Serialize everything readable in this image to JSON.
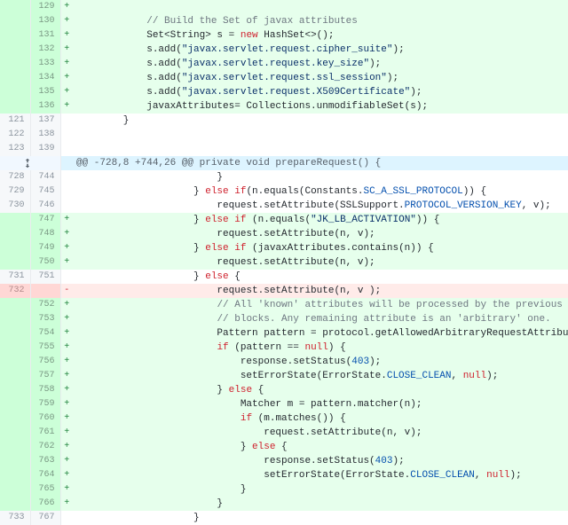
{
  "hunk_header": "@@ -728,8 +744,26 @@ private void prepareRequest() {",
  "lines": [
    {
      "o": "",
      "n": "129",
      "m": "+",
      "t": "add",
      "seg": [
        [
          "",
          ""
        ]
      ]
    },
    {
      "o": "",
      "n": "130",
      "m": "+",
      "t": "add",
      "seg": [
        [
          "",
          "            "
        ],
        [
          "cmt",
          "// Build the Set of javax attributes"
        ]
      ]
    },
    {
      "o": "",
      "n": "131",
      "m": "+",
      "t": "add",
      "seg": [
        [
          "",
          "            Set<String> s = "
        ],
        [
          "kw",
          "new"
        ],
        [
          "",
          " HashSet<>();"
        ]
      ]
    },
    {
      "o": "",
      "n": "132",
      "m": "+",
      "t": "add",
      "seg": [
        [
          "",
          "            s.add("
        ],
        [
          "str",
          "\"javax.servlet.request.cipher_suite\""
        ],
        [
          "",
          ");"
        ]
      ]
    },
    {
      "o": "",
      "n": "133",
      "m": "+",
      "t": "add",
      "seg": [
        [
          "",
          "            s.add("
        ],
        [
          "str",
          "\"javax.servlet.request.key_size\""
        ],
        [
          "",
          ");"
        ]
      ]
    },
    {
      "o": "",
      "n": "134",
      "m": "+",
      "t": "add",
      "seg": [
        [
          "",
          "            s.add("
        ],
        [
          "str",
          "\"javax.servlet.request.ssl_session\""
        ],
        [
          "",
          ");"
        ]
      ]
    },
    {
      "o": "",
      "n": "135",
      "m": "+",
      "t": "add",
      "seg": [
        [
          "",
          "            s.add("
        ],
        [
          "str",
          "\"javax.servlet.request.X509Certificate\""
        ],
        [
          "",
          ");"
        ]
      ]
    },
    {
      "o": "",
      "n": "136",
      "m": "+",
      "t": "add",
      "seg": [
        [
          "",
          "            javaxAttributes= Collections.unmodifiableSet(s);"
        ]
      ]
    },
    {
      "o": "121",
      "n": "137",
      "m": "",
      "t": "",
      "seg": [
        [
          "",
          "        }"
        ]
      ]
    },
    {
      "o": "122",
      "n": "138",
      "m": "",
      "t": "",
      "seg": [
        [
          "",
          ""
        ]
      ]
    },
    {
      "o": "123",
      "n": "139",
      "m": "",
      "t": "",
      "seg": [
        [
          "",
          ""
        ]
      ]
    },
    {
      "t": "hunk"
    },
    {
      "o": "728",
      "n": "744",
      "m": "",
      "t": "",
      "seg": [
        [
          "",
          "                        }"
        ]
      ]
    },
    {
      "o": "729",
      "n": "745",
      "m": "",
      "t": "",
      "seg": [
        [
          "",
          "                    } "
        ],
        [
          "kw",
          "else if"
        ],
        [
          "",
          "(n.equals(Constants."
        ],
        [
          "const",
          "SC_A_SSL_PROTOCOL"
        ],
        [
          "",
          ")) {"
        ]
      ]
    },
    {
      "o": "730",
      "n": "746",
      "m": "",
      "t": "",
      "seg": [
        [
          "",
          "                        request.setAttribute(SSLSupport."
        ],
        [
          "const",
          "PROTOCOL_VERSION_KEY"
        ],
        [
          "",
          ", v);"
        ]
      ]
    },
    {
      "o": "",
      "n": "747",
      "m": "+",
      "t": "add",
      "seg": [
        [
          "",
          "                    } "
        ],
        [
          "kw",
          "else if"
        ],
        [
          "",
          " (n.equals("
        ],
        [
          "str",
          "\"JK_LB_ACTIVATION\""
        ],
        [
          "",
          ")) {"
        ]
      ]
    },
    {
      "o": "",
      "n": "748",
      "m": "+",
      "t": "add",
      "seg": [
        [
          "",
          "                        request.setAttribute(n, v);"
        ]
      ]
    },
    {
      "o": "",
      "n": "749",
      "m": "+",
      "t": "add",
      "seg": [
        [
          "",
          "                    } "
        ],
        [
          "kw",
          "else if"
        ],
        [
          "",
          " (javaxAttributes.contains(n)) {"
        ]
      ]
    },
    {
      "o": "",
      "n": "750",
      "m": "+",
      "t": "add",
      "seg": [
        [
          "",
          "                        request.setAttribute(n, v);"
        ]
      ]
    },
    {
      "o": "731",
      "n": "751",
      "m": "",
      "t": "",
      "seg": [
        [
          "",
          "                    } "
        ],
        [
          "kw",
          "else"
        ],
        [
          "",
          " {"
        ]
      ]
    },
    {
      "o": "732",
      "n": "",
      "m": "-",
      "t": "del",
      "seg": [
        [
          "",
          "                        request.setAttribute(n, v );"
        ]
      ]
    },
    {
      "o": "",
      "n": "752",
      "m": "+",
      "t": "add",
      "seg": [
        [
          "",
          "                        "
        ],
        [
          "cmt",
          "// All 'known' attributes will be processed by the previous"
        ]
      ]
    },
    {
      "o": "",
      "n": "753",
      "m": "+",
      "t": "add",
      "seg": [
        [
          "",
          "                        "
        ],
        [
          "cmt",
          "// blocks. Any remaining attribute is an 'arbitrary' one."
        ]
      ]
    },
    {
      "o": "",
      "n": "754",
      "m": "+",
      "t": "add",
      "seg": [
        [
          "",
          "                        Pattern pattern = protocol.getAllowedArbitraryRequestAttributesPattern();"
        ]
      ]
    },
    {
      "o": "",
      "n": "755",
      "m": "+",
      "t": "add",
      "seg": [
        [
          "",
          "                        "
        ],
        [
          "kw",
          "if"
        ],
        [
          "",
          " (pattern == "
        ],
        [
          "kw",
          "null"
        ],
        [
          "",
          ") {"
        ]
      ]
    },
    {
      "o": "",
      "n": "756",
      "m": "+",
      "t": "add",
      "seg": [
        [
          "",
          "                            response.setStatus("
        ],
        [
          "num",
          "403"
        ],
        [
          "",
          ");"
        ]
      ]
    },
    {
      "o": "",
      "n": "757",
      "m": "+",
      "t": "add",
      "seg": [
        [
          "",
          "                            setErrorState(ErrorState."
        ],
        [
          "const",
          "CLOSE_CLEAN"
        ],
        [
          "",
          ", "
        ],
        [
          "kw",
          "null"
        ],
        [
          "",
          ");"
        ]
      ]
    },
    {
      "o": "",
      "n": "758",
      "m": "+",
      "t": "add",
      "seg": [
        [
          "",
          "                        } "
        ],
        [
          "kw",
          "else"
        ],
        [
          "",
          " {"
        ]
      ]
    },
    {
      "o": "",
      "n": "759",
      "m": "+",
      "t": "add",
      "seg": [
        [
          "",
          "                            Matcher m = pattern.matcher(n);"
        ]
      ]
    },
    {
      "o": "",
      "n": "760",
      "m": "+",
      "t": "add",
      "seg": [
        [
          "",
          "                            "
        ],
        [
          "kw",
          "if"
        ],
        [
          "",
          " (m.matches()) {"
        ]
      ]
    },
    {
      "o": "",
      "n": "761",
      "m": "+",
      "t": "add",
      "seg": [
        [
          "",
          "                                request.setAttribute(n, v);"
        ]
      ]
    },
    {
      "o": "",
      "n": "762",
      "m": "+",
      "t": "add",
      "seg": [
        [
          "",
          "                            } "
        ],
        [
          "kw",
          "else"
        ],
        [
          "",
          " {"
        ]
      ]
    },
    {
      "o": "",
      "n": "763",
      "m": "+",
      "t": "add",
      "seg": [
        [
          "",
          "                                response.setStatus("
        ],
        [
          "num",
          "403"
        ],
        [
          "",
          ");"
        ]
      ]
    },
    {
      "o": "",
      "n": "764",
      "m": "+",
      "t": "add",
      "seg": [
        [
          "",
          "                                setErrorState(ErrorState."
        ],
        [
          "const",
          "CLOSE_CLEAN"
        ],
        [
          "",
          ", "
        ],
        [
          "kw",
          "null"
        ],
        [
          "",
          ");"
        ]
      ]
    },
    {
      "o": "",
      "n": "765",
      "m": "+",
      "t": "add",
      "seg": [
        [
          "",
          "                            }"
        ]
      ]
    },
    {
      "o": "",
      "n": "766",
      "m": "+",
      "t": "add",
      "seg": [
        [
          "",
          "                        }"
        ]
      ]
    },
    {
      "o": "733",
      "n": "767",
      "m": "",
      "t": "",
      "seg": [
        [
          "",
          "                    }"
        ]
      ]
    }
  ]
}
